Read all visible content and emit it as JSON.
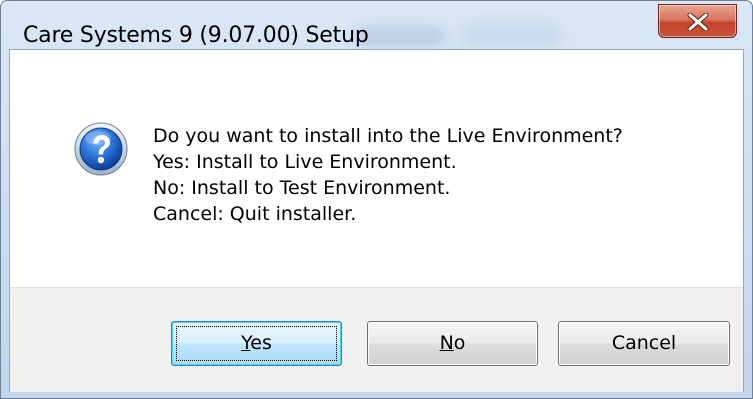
{
  "window": {
    "title": "Care Systems 9  (9.07.00) Setup"
  },
  "icons": {
    "dialog": "question-icon",
    "close": "close-icon"
  },
  "message": {
    "lines": [
      "Do you want to install into the Live Environment?",
      "Yes: Install to Live Environment.",
      "No: Install to Test Environment.",
      "Cancel: Quit installer."
    ]
  },
  "buttons": {
    "yes": {
      "hotkey": "Y",
      "rest": "es"
    },
    "no": {
      "hotkey": "N",
      "rest": "o"
    },
    "cancel": {
      "label": "Cancel"
    }
  },
  "colors": {
    "close_button": "#c9543a",
    "default_button_border": "#3c7fb1",
    "question_icon": "#1f62c7"
  }
}
